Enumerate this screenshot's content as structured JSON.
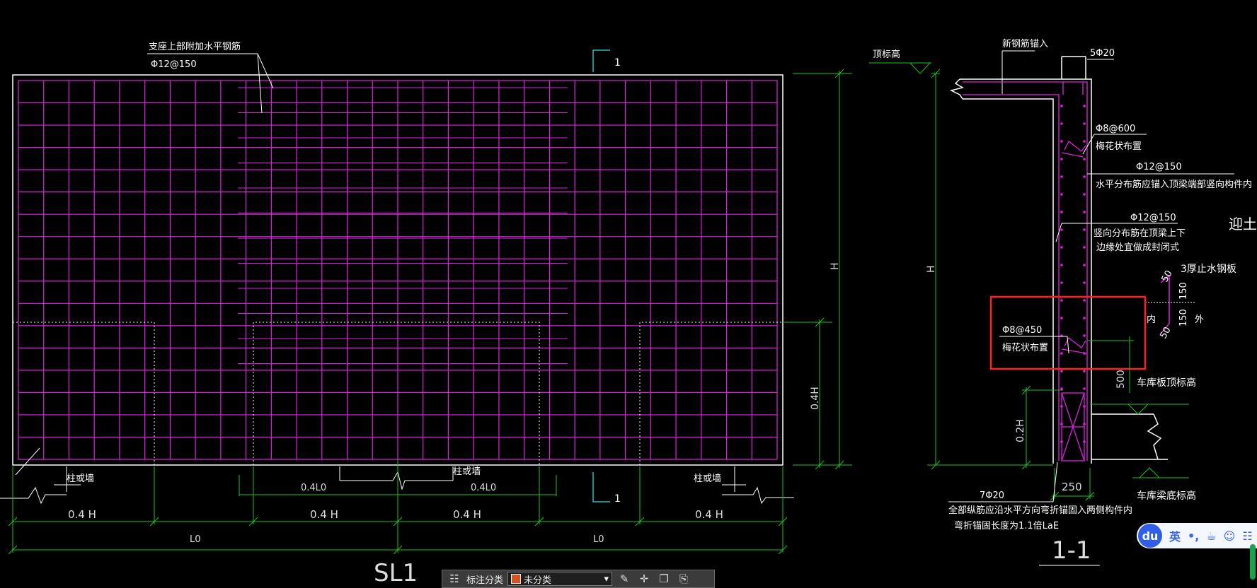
{
  "drawing": {
    "elevation_title": "SL1",
    "section_title": "1-1",
    "section_mark": "1",
    "colors": {
      "rebar": "#e020e0",
      "dimension": "#20c020",
      "outline": "#ffffff",
      "highlight": "#ff2020"
    }
  },
  "elevation": {
    "top_bar_note": "支座上部附加水平钢筋",
    "top_bar_spec": "Φ12@150",
    "col_wall_label": "柱或墙",
    "dim_0_4H": "0.4 H",
    "dim_0_4L0": "0.4L0",
    "dim_L0": "L0",
    "dim_H": "H",
    "dim_0_4H_vert": "0.4H"
  },
  "section": {
    "top_elev_label": "顶标高",
    "new_rebar_label": "新钢筋锚入",
    "top_rebar": "5Φ20",
    "tie_spec_top": "Φ8@600",
    "tie_note_top": "梅花状布置",
    "horiz_bar_spec": "Φ12@150",
    "horiz_bar_note": "水平分布筋应锚入顶梁端部竖向构件内",
    "vert_bar_spec": "Φ12@150",
    "vert_bar_note_1": "竖向分布筋在顶梁上下",
    "vert_bar_note_2": "边缘处宜做成封闭式",
    "waterstop_label": "3厚止水钢板",
    "ws_dim_50a": "50",
    "ws_dim_150a": "150",
    "ws_dim_150b": "150",
    "ws_dim_50b": "50",
    "inner_label": "内",
    "outer_label": "外",
    "side_label": "迎土侧",
    "tie_spec_bottom": "Φ8@450",
    "tie_note_bottom": "梅花状布置",
    "dim_500": "500",
    "garage_top_label": "车库板顶标高",
    "dim_0_2H": "0.2H",
    "dim_H": "H",
    "dim_250": "250",
    "garage_bottom_label": "车库梁底标高",
    "bottom_rebar": "7Φ20",
    "bottom_note_1": "全部纵筋应沿水平方向弯折锚固入两侧构件内",
    "bottom_note_2": "弯折锚固长度为1.1倍LaE"
  },
  "toolbar": {
    "label": "标注分类",
    "selected": "未分类",
    "selected_color": "#d9531e",
    "icons": [
      "edit-icon",
      "move-icon",
      "copy-icon",
      "paste-icon"
    ]
  },
  "ime": {
    "logo": "du",
    "lang": "英",
    "punct": "•,",
    "icons": [
      "cup-icon",
      "user-icon",
      "grid-icon"
    ]
  }
}
